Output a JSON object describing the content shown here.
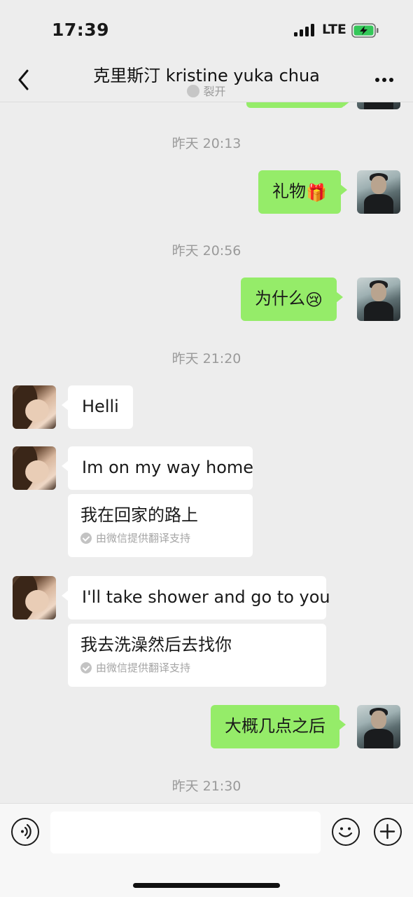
{
  "status_bar": {
    "time": "17:39",
    "network": "LTE"
  },
  "header": {
    "title": "克里斯汀 kristine yuka chua",
    "subtitle": "裂开",
    "back_icon": "chevron-left-icon",
    "more_icon": "more-dots-icon"
  },
  "messages": {
    "ts1": "昨天 20:13",
    "m1": {
      "text": "礼物",
      "emoji": "🎁"
    },
    "ts2": "昨天 20:56",
    "m2": {
      "text": "为什么",
      "emoji": "😢"
    },
    "ts3": "昨天 21:20",
    "m3": {
      "text": "Helli"
    },
    "m4": {
      "text": "Im on my way home",
      "translation": "我在回家的路上",
      "note": "由微信提供翻译支持"
    },
    "m5": {
      "text": "I'll take shower and go to you",
      "translation": "我去洗澡然后去找你",
      "note": "由微信提供翻译支持"
    },
    "m6": {
      "text": "大概几点之后"
    },
    "ts4": "昨天 21:30"
  },
  "input_bar": {
    "placeholder": ""
  },
  "colors": {
    "my_bubble": "#95ec69",
    "their_bubble": "#ffffff",
    "background": "#ededed"
  }
}
